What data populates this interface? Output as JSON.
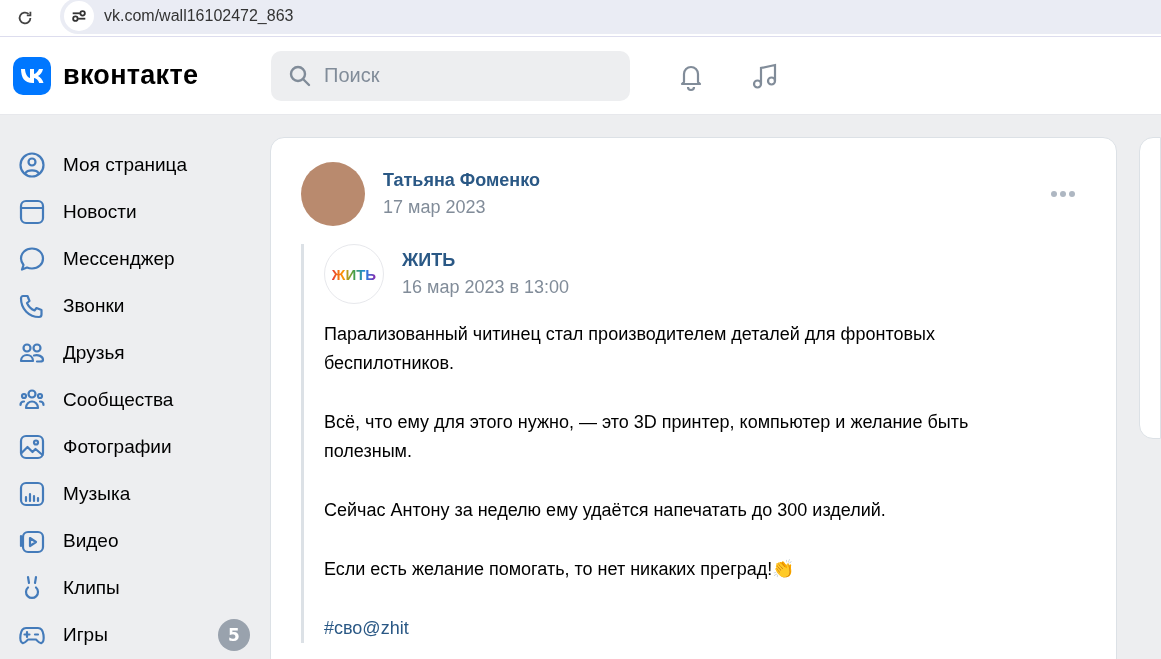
{
  "browser": {
    "url": "vk.com/wall16102472_863"
  },
  "header": {
    "logo_text": "вконтакте",
    "search": {
      "placeholder": "Поиск"
    }
  },
  "sidebar": {
    "items": [
      {
        "kind": "profile",
        "label": "Моя страница"
      },
      {
        "kind": "news",
        "label": "Новости"
      },
      {
        "kind": "messenger",
        "label": "Мессенджер"
      },
      {
        "kind": "calls",
        "label": "Звонки"
      },
      {
        "kind": "friends",
        "label": "Друзья"
      },
      {
        "kind": "communities",
        "label": "Сообщества"
      },
      {
        "kind": "photos",
        "label": "Фотографии"
      },
      {
        "kind": "music",
        "label": "Музыка"
      },
      {
        "kind": "video",
        "label": "Видео"
      },
      {
        "kind": "clips",
        "label": "Клипы"
      },
      {
        "kind": "games",
        "label": "Игры",
        "badge": "5"
      }
    ]
  },
  "post": {
    "author": "Татьяна Фоменко",
    "date": "17 мар 2023",
    "repost": {
      "logo_text": "ЖИТЬ",
      "author": "ЖИТЬ",
      "date": "16 мар 2023 в 13:00",
      "paragraphs": [
        "Парализованный читинец стал производителем деталей для фронтовых беспилотников.",
        "Всё, что ему для этого нужно, — это 3D принтер, компьютер и желание быть полезным.",
        "Сейчас Антону за неделю ему удаётся напечатать до 300 изделий.",
        "Если есть желание помогать, то нет никаких преград!👏"
      ],
      "hashtag": "#сво@zhit"
    }
  }
}
